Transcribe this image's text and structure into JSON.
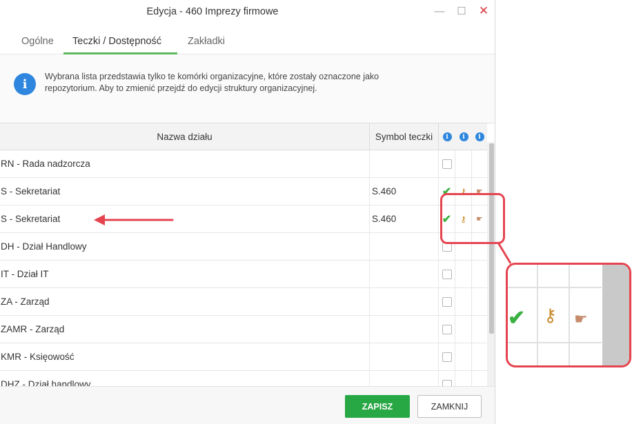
{
  "window": {
    "title": "Edycja - 460 Imprezy firmowe",
    "minimize": "—",
    "maximize": "☐",
    "close": "✕"
  },
  "tabs": [
    "Ogólne",
    "Teczki / Dostępność",
    "Zakładki"
  ],
  "active_tab": "Teczki / Dostępność",
  "info": {
    "icon": "i",
    "text_line1": "Wybrana lista przedstawia tylko te komórki organizacyjne, które zostały oznaczone jako",
    "text_line2": "repozytorium. Aby to zmienić przejdź do edycji struktury organizacyjnej."
  },
  "table": {
    "col_name": "Nazwa działu",
    "col_symbol": "Symbol teczki",
    "info_glyph": "i",
    "rows": [
      {
        "name": "RN - Rada nadzorcza",
        "symbol": "",
        "state": "unchecked"
      },
      {
        "name": "S - Sekretariat",
        "symbol": "S.460",
        "state": "checked"
      },
      {
        "name": "S - Sekretariat",
        "symbol": "S.460",
        "state": "checked"
      },
      {
        "name": "DH - Dział Handlowy",
        "symbol": "",
        "state": "unchecked"
      },
      {
        "name": "IT - Dział IT",
        "symbol": "",
        "state": "unchecked"
      },
      {
        "name": "ZA - Zarząd",
        "symbol": "",
        "state": "unchecked"
      },
      {
        "name": "ZAMR - Zarząd",
        "symbol": "",
        "state": "unchecked"
      },
      {
        "name": "KMR - Księowość",
        "symbol": "",
        "state": "unchecked"
      },
      {
        "name": "DHZ - Dział handlowy",
        "symbol": "",
        "state": "unchecked"
      }
    ]
  },
  "icons": {
    "tick": "✔",
    "key": "⚷",
    "hand": "☛"
  },
  "buttons": {
    "save": "ZAPISZ",
    "close": "ZAMKNIJ"
  },
  "colors": {
    "accent_green": "#28a745",
    "info_blue": "#2e86de",
    "annotation_red": "#e5444f"
  }
}
